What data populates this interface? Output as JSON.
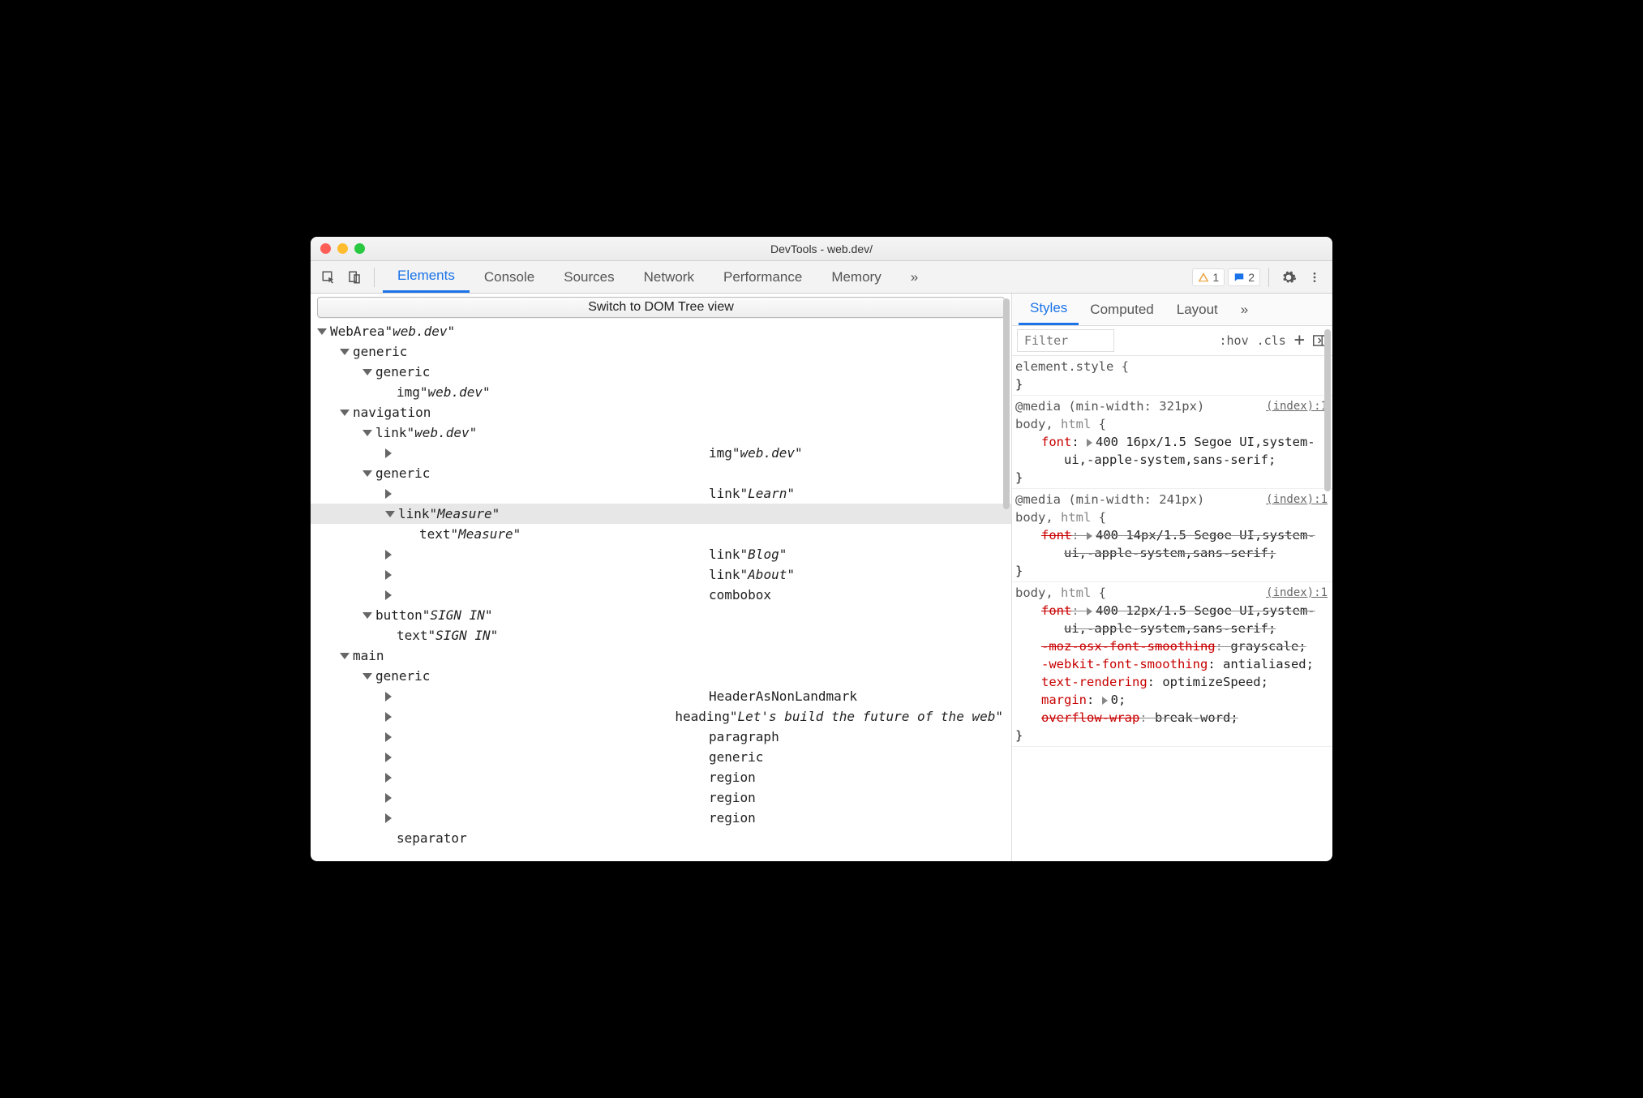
{
  "window": {
    "title": "DevTools - web.dev/"
  },
  "toolbar": {
    "tabs": [
      "Elements",
      "Console",
      "Sources",
      "Network",
      "Performance",
      "Memory"
    ],
    "more": "»",
    "warn_count": "1",
    "info_count": "2"
  },
  "left": {
    "banner": "Switch to DOM Tree view",
    "tree": [
      {
        "d": 0,
        "a": "down",
        "role": "WebArea",
        "name": "web.dev"
      },
      {
        "d": 1,
        "a": "down",
        "role": "generic"
      },
      {
        "d": 2,
        "a": "down",
        "role": "generic"
      },
      {
        "d": 3,
        "a": "",
        "role": "img",
        "name": "web.dev"
      },
      {
        "d": 1,
        "a": "down",
        "role": "navigation"
      },
      {
        "d": 2,
        "a": "down",
        "role": "link",
        "name": "web.dev"
      },
      {
        "d": 3,
        "a": "right",
        "role": "img",
        "name": "web.dev"
      },
      {
        "d": 2,
        "a": "down",
        "role": "generic"
      },
      {
        "d": 3,
        "a": "right",
        "role": "link",
        "name": "Learn"
      },
      {
        "d": 3,
        "a": "down",
        "role": "link",
        "name": "Measure",
        "sel": true
      },
      {
        "d": 4,
        "a": "",
        "role": "text",
        "name": "Measure"
      },
      {
        "d": 3,
        "a": "right",
        "role": "link",
        "name": "Blog"
      },
      {
        "d": 3,
        "a": "right",
        "role": "link",
        "name": "About"
      },
      {
        "d": 3,
        "a": "right",
        "role": "combobox"
      },
      {
        "d": 2,
        "a": "down",
        "role": "button",
        "name": "SIGN IN"
      },
      {
        "d": 3,
        "a": "",
        "role": "text",
        "name": "SIGN IN"
      },
      {
        "d": 1,
        "a": "down",
        "role": "main"
      },
      {
        "d": 2,
        "a": "down",
        "role": "generic"
      },
      {
        "d": 3,
        "a": "right",
        "role": "HeaderAsNonLandmark"
      },
      {
        "d": 3,
        "a": "right",
        "role": "heading",
        "name": "Let's build the future of the web"
      },
      {
        "d": 3,
        "a": "right",
        "role": "paragraph"
      },
      {
        "d": 3,
        "a": "right",
        "role": "generic"
      },
      {
        "d": 3,
        "a": "right",
        "role": "region"
      },
      {
        "d": 3,
        "a": "right",
        "role": "region"
      },
      {
        "d": 3,
        "a": "right",
        "role": "region"
      },
      {
        "d": 3,
        "a": "",
        "role": "separator"
      }
    ]
  },
  "right": {
    "tabs": [
      "Styles",
      "Computed",
      "Layout"
    ],
    "more": "»",
    "filter_placeholder": "Filter",
    "hov": ":hov",
    "cls": ".cls",
    "rules": [
      {
        "sel": "element.style {",
        "close": "}",
        "src": "",
        "decls": []
      },
      {
        "media": "@media (min-width: 321px)",
        "sel_left": "body,",
        "sel_right": "html",
        "close": "}",
        "src": "(index):1",
        "decls": [
          {
            "p": "font",
            "v": "400 16px/1.5 Segoe UI,system-ui,-apple-system,sans-serif;",
            "t": true
          }
        ]
      },
      {
        "media": "@media (min-width: 241px)",
        "sel_left": "body,",
        "sel_right": "html",
        "close": "}",
        "src": "(index):1",
        "decls": [
          {
            "p": "font",
            "v": "400 14px/1.5 Segoe UI,system-ui,-apple-system,sans-serif;",
            "t": true,
            "s": true
          }
        ]
      },
      {
        "sel_left": "body,",
        "sel_right": "html",
        "close": "}",
        "src": "(index):1",
        "decls": [
          {
            "p": "font",
            "v": "400 12px/1.5 Segoe UI,system-ui,-apple-system,sans-serif;",
            "t": true,
            "s": true
          },
          {
            "p": "-moz-osx-font-smoothing",
            "v": "grayscale;",
            "s": true
          },
          {
            "p": "-webkit-font-smoothing",
            "v": "antialiased;"
          },
          {
            "p": "text-rendering",
            "v": "optimizeSpeed;"
          },
          {
            "p": "margin",
            "v": "0;",
            "t": true
          },
          {
            "p": "overflow-wrap",
            "v": "break-word;",
            "s": true
          }
        ]
      }
    ]
  }
}
